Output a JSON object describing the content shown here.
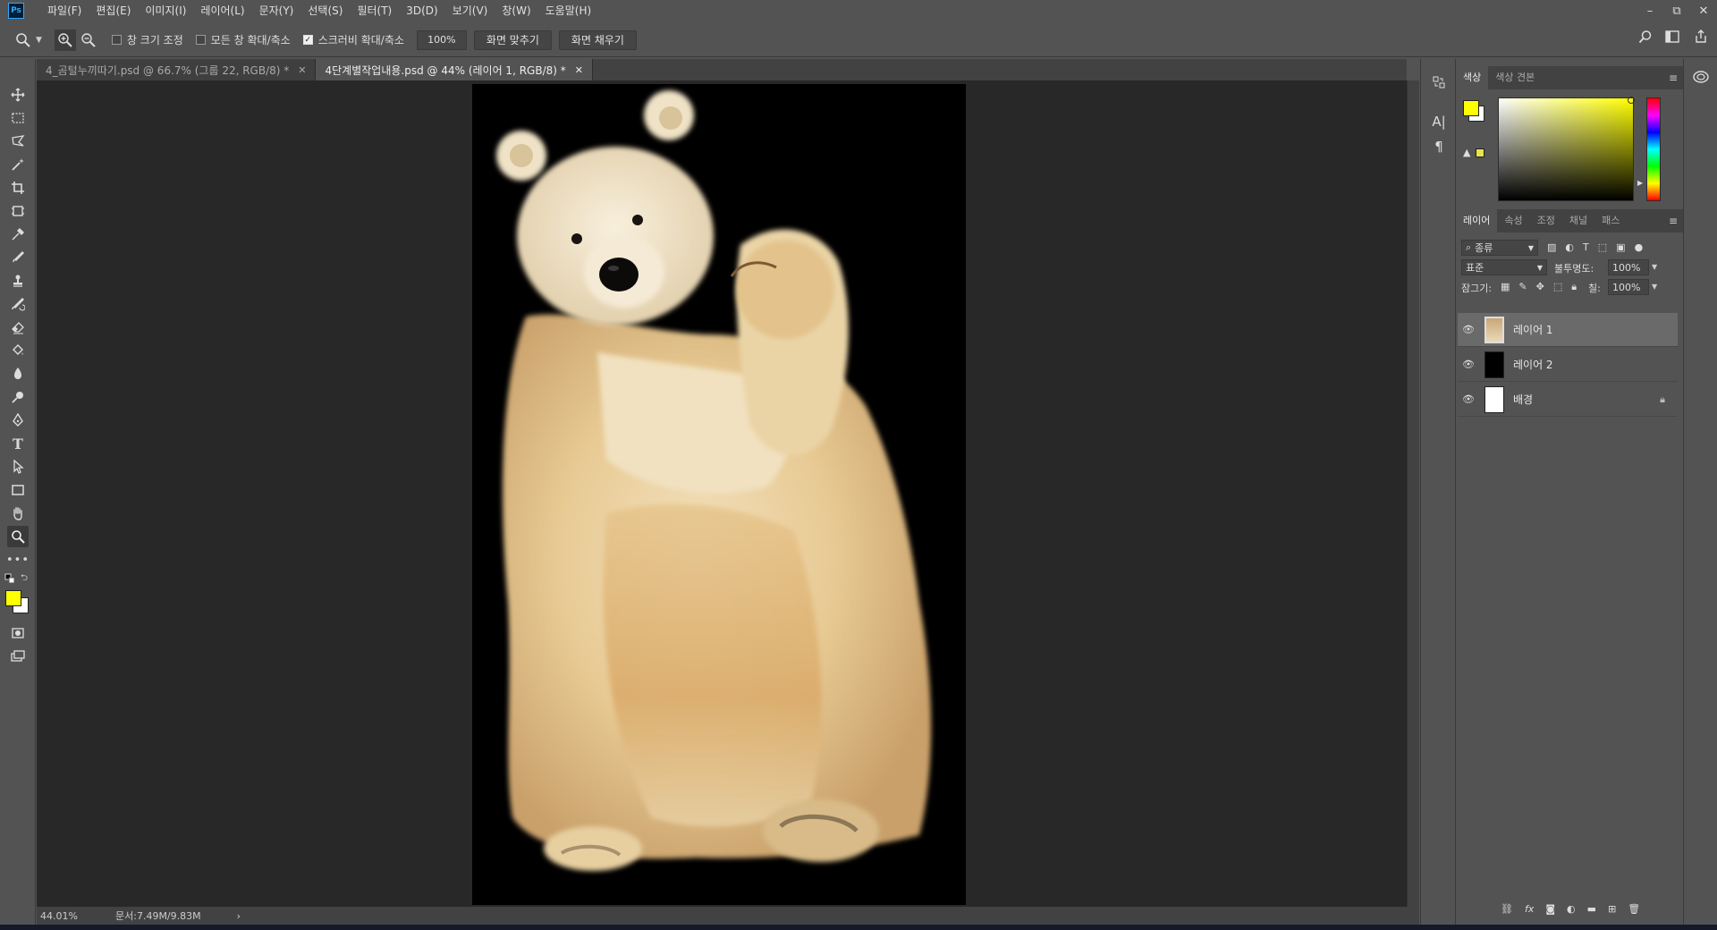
{
  "app": {
    "logo": "Ps",
    "menu": [
      "파일(F)",
      "편집(E)",
      "이미지(I)",
      "레이어(L)",
      "문자(Y)",
      "선택(S)",
      "필터(T)",
      "3D(D)",
      "보기(V)",
      "창(W)",
      "도움말(H)"
    ],
    "window_controls": [
      "–",
      "⧉",
      "✕"
    ]
  },
  "options_bar": {
    "tool_icon": "zoom-icon",
    "resize_windows_label": "창 크기 조정",
    "resize_windows_checked": false,
    "zoom_all_label": "모든 창 확대/축소",
    "zoom_all_checked": false,
    "scrubby_label": "스크러비 확대/축소",
    "scrubby_checked": true,
    "zoom_value": "100%",
    "fit_screen_label": "화면 맞추기",
    "fill_screen_label": "화면 채우기"
  },
  "tabs": [
    {
      "label": "4_곰털누끼따기.psd @ 66.7% (그룹 22, RGB/8) *",
      "active": false
    },
    {
      "label": "4단계별작업내용.psd @ 44% (레이어 1, RGB/8) *",
      "active": true
    }
  ],
  "status": {
    "zoom": "44.01%",
    "doc_size": "문서:7.49M/9.83M",
    "arrow": "›"
  },
  "color_panel": {
    "tabs": [
      "색상",
      "색상 견본"
    ],
    "foreground": "#ffff00",
    "background": "#ffffff"
  },
  "layers_panel": {
    "tabs": [
      "레이어",
      "속성",
      "조정",
      "채널",
      "패스"
    ],
    "filter_label": "종류",
    "blend_mode": "표준",
    "opacity_label": "불투명도:",
    "opacity_value": "100%",
    "lock_label": "잠그기:",
    "fill_label": "칠:",
    "fill_value": "100%",
    "layers": [
      {
        "name": "레이어 1",
        "selected": true,
        "thumb": "bear",
        "locked": false
      },
      {
        "name": "레이어 2",
        "selected": false,
        "thumb": "#000000",
        "locked": false
      },
      {
        "name": "배경",
        "selected": false,
        "thumb": "#ffffff",
        "locked": true
      }
    ]
  }
}
